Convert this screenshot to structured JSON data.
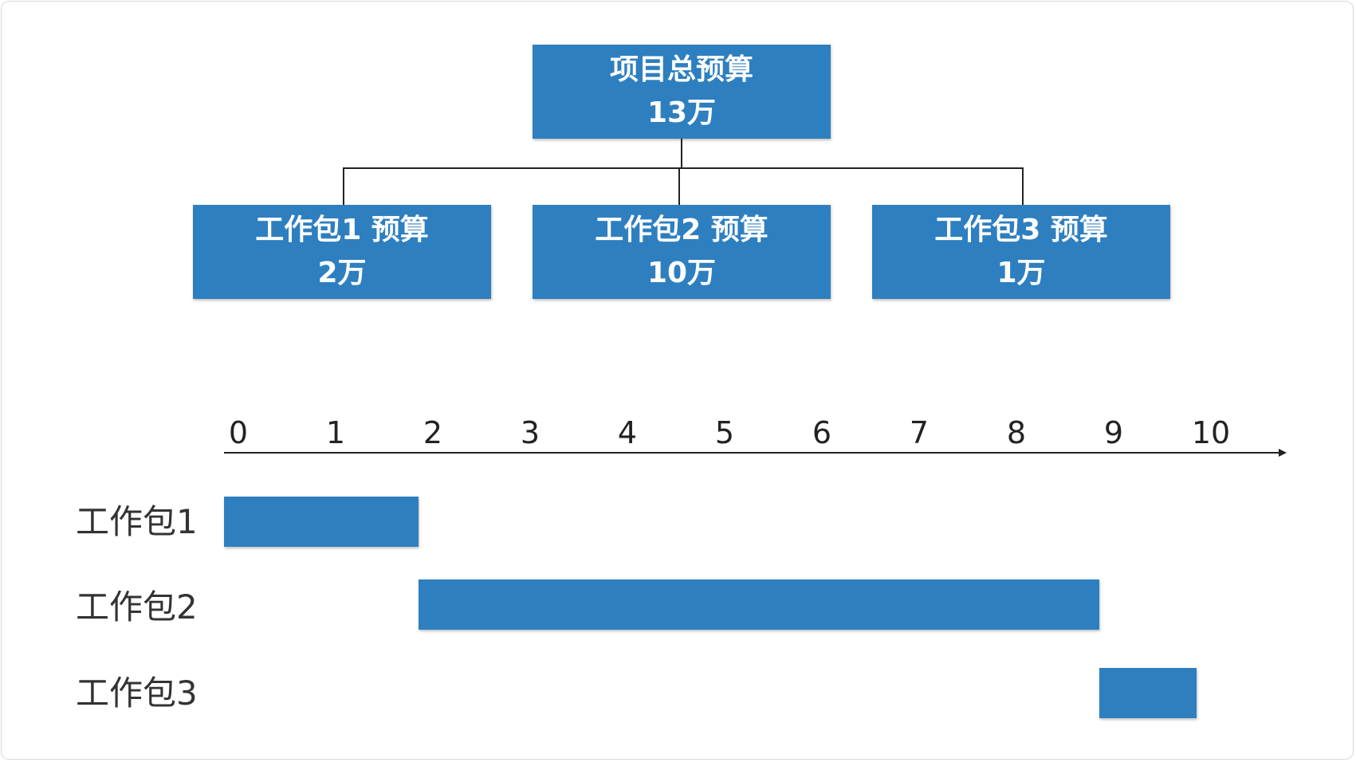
{
  "colors": {
    "box_fill": "#2e7fbf",
    "text_on_box": "#ffffff",
    "line": "#222222"
  },
  "tree": {
    "root": {
      "title": "项目总预算",
      "value": "13万"
    },
    "children": [
      {
        "title": "工作包1 预算",
        "value": "2万"
      },
      {
        "title": "工作包2 预算",
        "value": "10万"
      },
      {
        "title": "工作包3 预算",
        "value": "1万"
      }
    ]
  },
  "timeline": {
    "ticks": [
      "0",
      "1",
      "2",
      "3",
      "4",
      "5",
      "6",
      "7",
      "8",
      "9",
      "10"
    ],
    "tasks": [
      {
        "label": "工作包1",
        "start": 0,
        "end": 2
      },
      {
        "label": "工作包2",
        "start": 2,
        "end": 9
      },
      {
        "label": "工作包3",
        "start": 9,
        "end": 10
      }
    ]
  }
}
